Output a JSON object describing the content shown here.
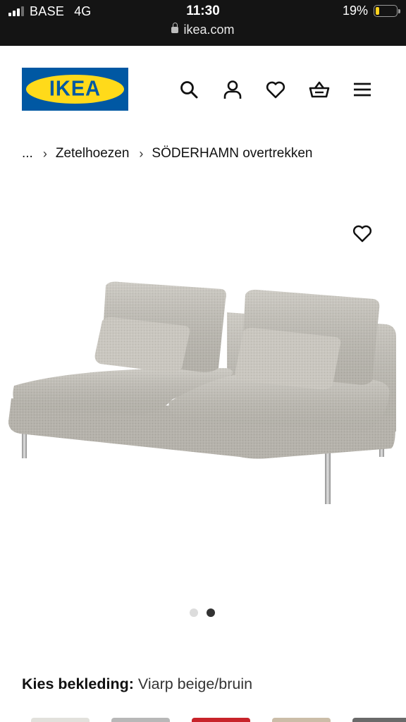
{
  "status_bar": {
    "carrier": "BASE",
    "network": "4G",
    "time": "11:30",
    "battery_percent": "19%",
    "battery_level": 0.19,
    "battery_color": "#ffd21e"
  },
  "address_bar": {
    "url": "ikea.com",
    "icon": "lock-icon"
  },
  "header": {
    "logo_text": "IKEA",
    "brand_colors": {
      "blue": "#0058a3",
      "yellow": "#ffda1a"
    },
    "icons": [
      "search-icon",
      "account-icon",
      "wishlist-icon",
      "basket-icon",
      "menu-icon"
    ]
  },
  "breadcrumb": {
    "items": [
      "...",
      "Zetelhoezen",
      "SÖDERHAMN overtrekken"
    ],
    "separator": "›"
  },
  "product": {
    "image_alt": "sofa-image",
    "favorite_icon": "heart-icon",
    "carousel": {
      "count": 2,
      "active_index": 1
    }
  },
  "upholstery": {
    "label": "Kies bekleding:",
    "value": "Viarp beige/bruin",
    "swatch_colors": [
      "#e2e1dc",
      "#b8b8b8",
      "#c8232a",
      "#cbbda8",
      "#6a6a6a"
    ]
  }
}
